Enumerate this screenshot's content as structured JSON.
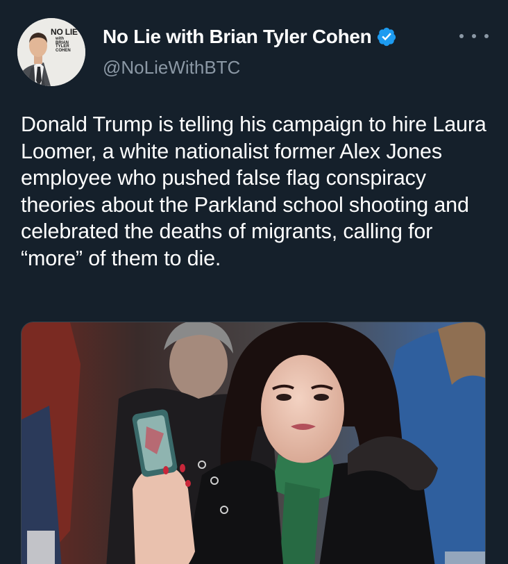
{
  "tweet": {
    "author": {
      "display_name": "No Lie with Brian Tyler Cohen",
      "handle": "@NoLieWithBTC",
      "verified": true,
      "avatar_logo_lines": [
        "NO LIE",
        "with",
        "BRIAN",
        "TYLER",
        "COHEN"
      ]
    },
    "text": "Donald Trump is telling his campaign to hire Laura Loomer, a white nationalist former Alex Jones employee who pushed false flag conspiracy theories about the Parkland school shooting and celebrated the deaths of migrants, calling for “more” of them to die.",
    "icons": {
      "verified": "verified-badge-icon",
      "more": "more-options-icon"
    }
  },
  "colors": {
    "background": "#15202b",
    "primary_text": "#ffffff",
    "secondary_text": "#8b98a5",
    "verified_blue": "#1d9bf0"
  }
}
